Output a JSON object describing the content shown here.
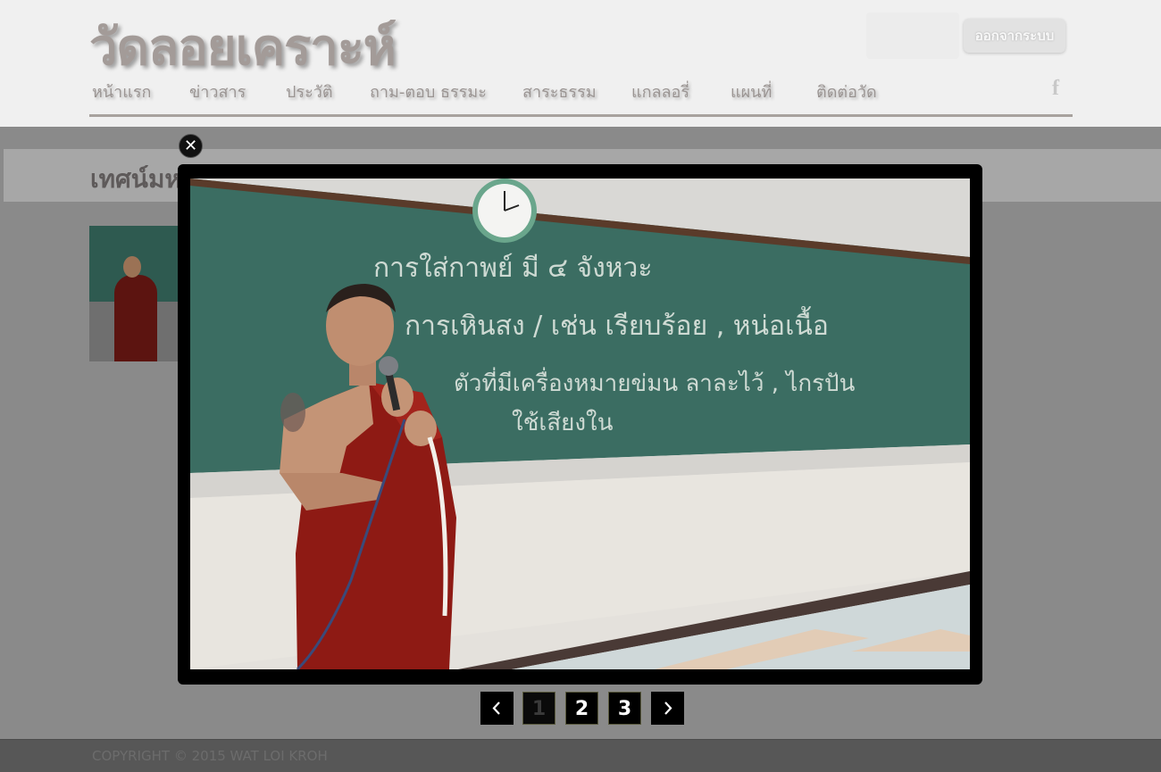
{
  "header": {
    "site_title": "วัดลอยเคราะห์",
    "logout_label": "ออกจากระบบ",
    "social_icon": "facebook-icon",
    "social_glyph": "f"
  },
  "nav": {
    "items": [
      {
        "label": "หน้าแรก"
      },
      {
        "label": "ข่าวสาร"
      },
      {
        "label": "ประวัติ"
      },
      {
        "label": "ถาม-ตอบ ธรรมะ"
      },
      {
        "label": "สาระธรรม"
      },
      {
        "label": "แกลลอรี่"
      },
      {
        "label": "แผนที่"
      },
      {
        "label": "ติดต่อวัด"
      }
    ]
  },
  "page": {
    "heading": "เทศน์มห"
  },
  "lightbox": {
    "close_glyph": "✕",
    "photo_alt": "พระภิกษุถือไมโครโฟนยืนหน้ากระดานดำ",
    "chalk_lines": [
      "การใส่กาพย์ มี ๔ จังหวะ",
      "การเหินสง   /   เช่น  เรียบร้อย , หน่อเนื้อ",
      "ตัวที่มีเครื่องหมายข่มน ลาละไว้ ,  ไกรปัน",
      "ใช้เสียงใน"
    ],
    "pagination": {
      "prev_icon": "chevron-left-icon",
      "next_icon": "chevron-right-icon",
      "pages": [
        "1",
        "2",
        "3"
      ],
      "current_page": 1
    }
  },
  "footer": {
    "copyright": "COPYRIGHT © 2015 WAT LOI KROH"
  },
  "colors": {
    "header_bg": "#f0f0f0",
    "title_color": "#a39b98",
    "overlay_bg": "#8a8a8a",
    "lightbox_bg": "#000000",
    "robe_red": "#8e1a14",
    "board_green": "#3a6b5f"
  }
}
